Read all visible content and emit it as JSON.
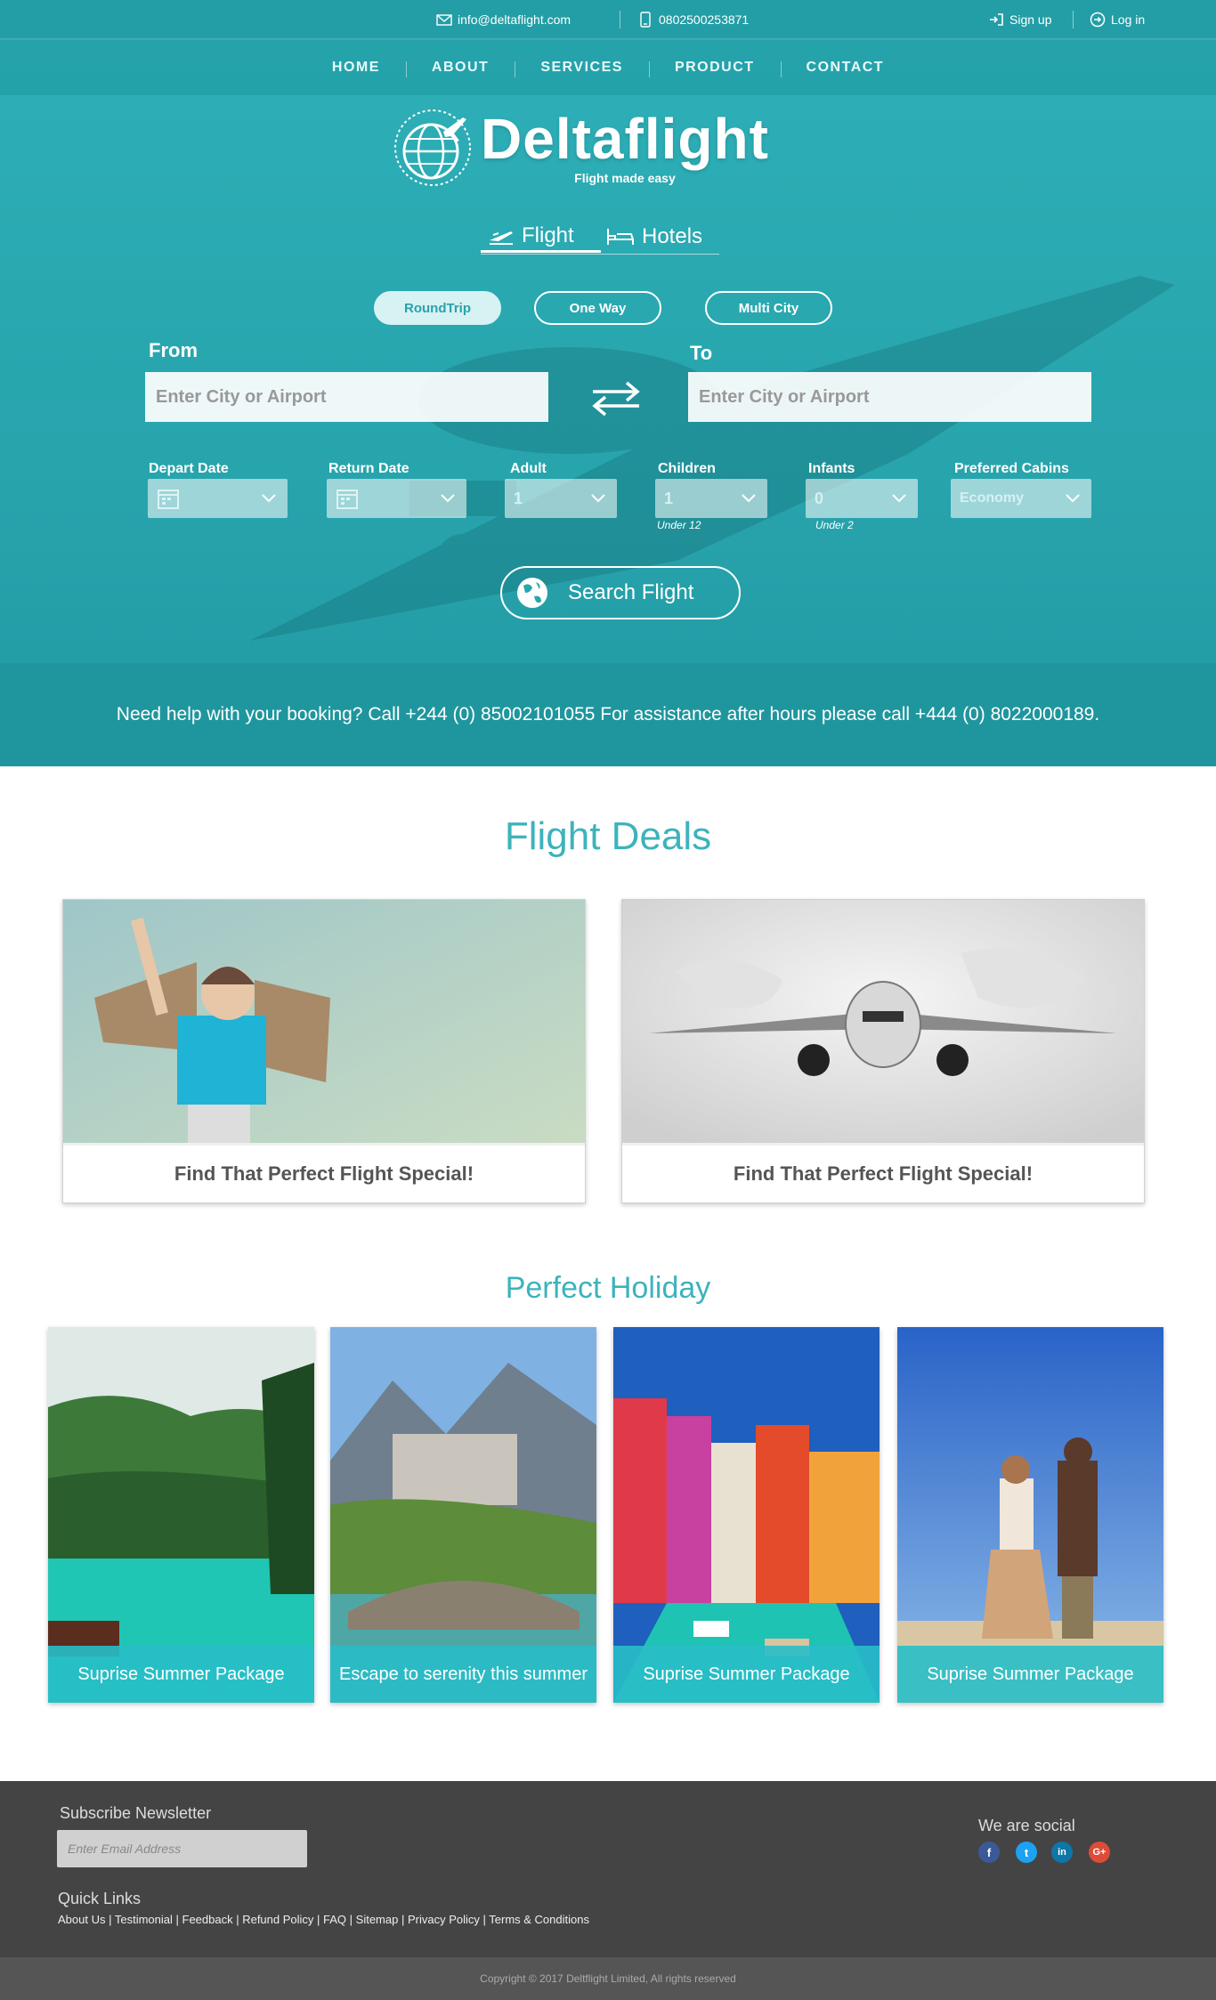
{
  "topbar": {
    "email": "info@deltaflight.com",
    "phone": "0802500253871",
    "signup": "Sign up",
    "login": "Log in"
  },
  "nav": [
    "HOME",
    "ABOUT",
    "SERVICES",
    "PRODUCT",
    "CONTACT"
  ],
  "brand": {
    "name": "Deltaflight",
    "tagline": "Flight made easy"
  },
  "mode_tabs": {
    "flight": "Flight",
    "hotels": "Hotels"
  },
  "trip_types": {
    "roundtrip": "RoundTrip",
    "oneway": "One Way",
    "multicity": "Multi City"
  },
  "search": {
    "from_label": "From",
    "to_label": "To",
    "from_placeholder": "Enter City or Airport",
    "to_placeholder": "Enter City or Airport",
    "depart_label": "Depart Date",
    "return_label": "Return Date",
    "adult_label": "Adult",
    "children_label": "Children",
    "infants_label": "Infants",
    "cabins_label": "Preferred Cabins",
    "adult_value": "1",
    "children_value": "1",
    "infants_value": "0",
    "cabins_value": "Economy",
    "children_note": "Under 12",
    "infants_note": "Under 2",
    "button": "Search Flight"
  },
  "help_text": "Need help with your booking? Call  +244 (0) 85002101055 For assistance after hours please call +444 (0) 8022000189.",
  "deals": {
    "title": "Flight Deals",
    "items": [
      "Find That Perfect Flight Special!",
      "Find That Perfect Flight Special!"
    ]
  },
  "holiday": {
    "title": "Perfect Holiday",
    "items": [
      "Suprise Summer Package",
      "Escape to serenity this summer",
      "Suprise Summer Package",
      "Suprise Summer Package"
    ]
  },
  "footer": {
    "newsletter_title": "Subscribe Newsletter",
    "email_placeholder": "Enter Email Address",
    "quick_links_title": "Quick Links",
    "links": [
      "About Us",
      "Testimonial",
      "Feedback",
      "Refund Policy",
      "FAQ",
      "Sitemap",
      "Privacy Policy",
      "Terms & Conditions"
    ],
    "social_title": "We are social",
    "social": [
      "f",
      "t",
      "in",
      "G+"
    ],
    "copyright": "Copyright © 2017 Deltflight Limited, All rights reserved"
  },
  "colors": {
    "teal": "#2fb0b8",
    "dark_teal": "#1f969e",
    "footer": "#444444",
    "heading": "#3db3bb"
  }
}
